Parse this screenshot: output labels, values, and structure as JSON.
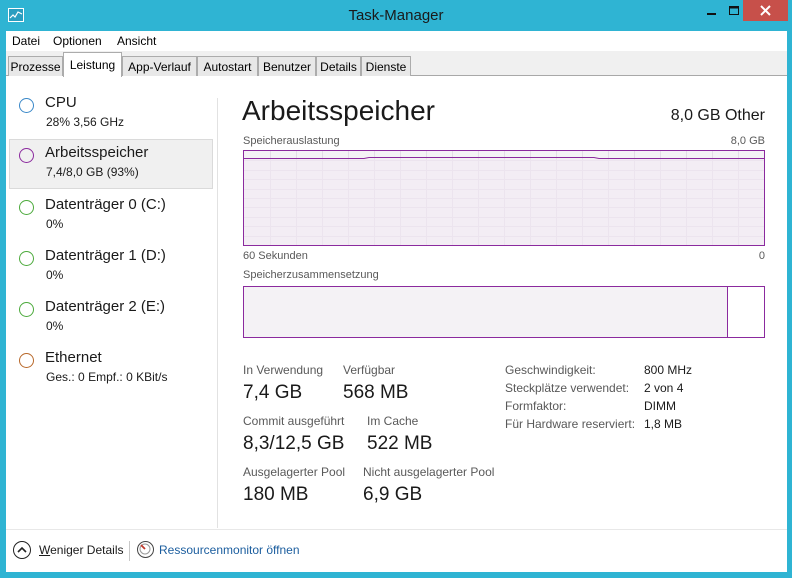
{
  "window": {
    "title": "Task-Manager"
  },
  "menu": [
    "Datei",
    "Optionen",
    "Ansicht"
  ],
  "tabs": [
    "Prozesse",
    "Leistung",
    "App-Verlauf",
    "Autostart",
    "Benutzer",
    "Details",
    "Dienste"
  ],
  "active_tab": "Leistung",
  "sidebar": {
    "items": [
      {
        "name": "CPU",
        "detail": "28%  3,56 GHz",
        "color": "#3a88c8",
        "selected": false
      },
      {
        "name": "Arbeitsspeicher",
        "detail": "7,4/8,0 GB (93%)",
        "color": "#8b2a9e",
        "selected": true
      },
      {
        "name": "Datenträger 0 (C:)",
        "detail": "0%",
        "color": "#4caa3c",
        "selected": false
      },
      {
        "name": "Datenträger 1 (D:)",
        "detail": "0%",
        "color": "#4caa3c",
        "selected": false
      },
      {
        "name": "Datenträger 2 (E:)",
        "detail": "0%",
        "color": "#4caa3c",
        "selected": false
      },
      {
        "name": "Ethernet",
        "detail_send_label": "Ges.:",
        "detail_send": "0",
        "detail_recv_label": "Empf.:",
        "detail_recv": "0 KBit/s",
        "color": "#b8682a",
        "selected": false
      }
    ]
  },
  "main": {
    "title": "Arbeitsspeicher",
    "total": "8,0 GB Other",
    "usage_graph": {
      "label": "Speicherauslastung",
      "max_label": "8,0 GB",
      "left_time": "60 Sekunden",
      "right_time": "0",
      "usage_fraction": 0.93,
      "line_color": "#8b2a9e"
    },
    "composition": {
      "label": "Speicherzusammensetzung",
      "in_use_fraction": 0.93
    },
    "stats": {
      "in_use_label": "In Verwendung",
      "in_use_value": "7,4 GB",
      "available_label": "Verfügbar",
      "available_value": "568 MB",
      "committed_label": "Commit ausgeführt",
      "committed_value": "8,3/12,5 GB",
      "cached_label": "Im Cache",
      "cached_value": "522 MB",
      "paged_label": "Ausgelagerter Pool",
      "paged_value": "180 MB",
      "nonpaged_label": "Nicht ausgelagerter Pool",
      "nonpaged_value": "6,9 GB"
    },
    "properties": [
      {
        "label": "Geschwindigkeit:",
        "value": "800 MHz"
      },
      {
        "label": "Steckplätze verwendet:",
        "value": "2 von 4"
      },
      {
        "label": "Formfaktor:",
        "value": "DIMM"
      },
      {
        "label": "Für Hardware reserviert:",
        "value": "1,8 MB"
      }
    ]
  },
  "footer": {
    "fewer_details_accel": "W",
    "fewer_details_rest": "eniger Details",
    "resource_monitor": "Ressourcenmonitor öffnen"
  }
}
